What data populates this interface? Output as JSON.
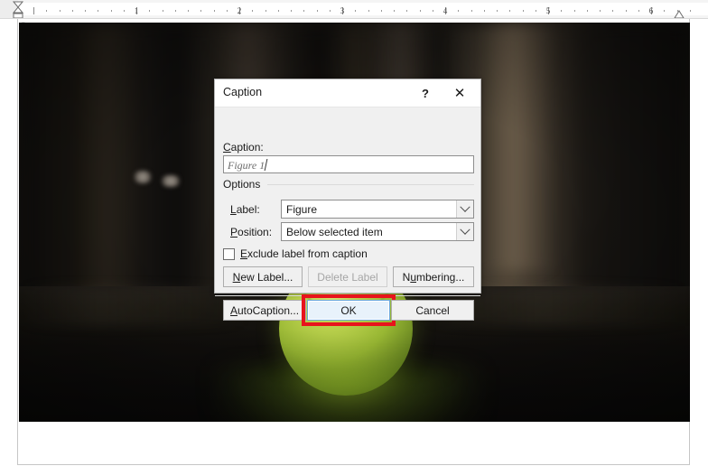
{
  "ruler": {
    "numbers": [
      1,
      2,
      3,
      4,
      5,
      6
    ],
    "unit": "inch",
    "left_indent_marker": "hanging-indent-marker",
    "right_indent_marker": "right-indent-marker"
  },
  "document": {
    "paragraph_mark": "¶",
    "image_alt": "blurred dark photograph of a green ball on a reflective dark table"
  },
  "dialog": {
    "title": "Caption",
    "help_icon": "?",
    "close_icon": "✕",
    "caption_field": {
      "label": "Caption:",
      "value": "Figure 1",
      "placeholder": "Figure 1"
    },
    "options_group": {
      "title": "Options",
      "label_field": {
        "label": "Label:",
        "value": "Figure"
      },
      "position_field": {
        "label": "Position:",
        "value": "Below selected item"
      },
      "exclude_checkbox": {
        "label": "Exclude label from caption",
        "checked": false
      },
      "buttons": {
        "new_label": "New Label...",
        "delete_label": "Delete Label",
        "delete_label_disabled": true,
        "numbering": "Numbering..."
      }
    },
    "footer_buttons": {
      "autocaption": "AutoCaption...",
      "ok": "OK",
      "cancel": "Cancel"
    },
    "highlight": {
      "target": "OK",
      "color": "#e8131c"
    }
  },
  "colors": {
    "dialog_bg": "#f0f0f0",
    "titlebar_bg": "#ffffff",
    "focus_blue": "#6ba8d8",
    "focus_fill": "#e8f2fb",
    "highlight_red": "#e8131c",
    "ball_green": "#a8c23d",
    "page_bg": "#ffffff"
  }
}
